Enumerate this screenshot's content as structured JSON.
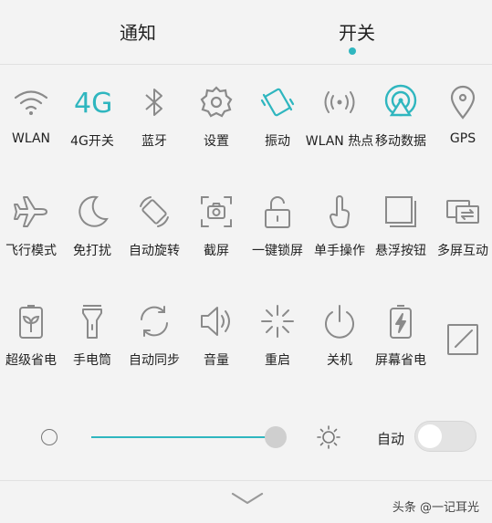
{
  "tabs": {
    "notify": "通知",
    "switch": "开关"
  },
  "tiles": {
    "wlan": "WLAN",
    "fourg_icon": "4G",
    "fourg": "4G开关",
    "bluetooth": "蓝牙",
    "settings": "设置",
    "vibrate": "振动",
    "hotspot": "WLAN 热点",
    "mobile_data": "移动数据",
    "gps": "GPS",
    "airplane": "飞行模式",
    "dnd": "免打扰",
    "autorotate": "自动旋转",
    "screenshot": "截屏",
    "lock": "一键锁屏",
    "one_hand": "单手操作",
    "float": "悬浮按钮",
    "multiscreen": "多屏互动",
    "power_saver": "超级省电",
    "flashlight": "手电筒",
    "sync": "自动同步",
    "volume": "音量",
    "restart": "重启",
    "shutdown": "关机",
    "screen_saver": "屏幕省电"
  },
  "brightness": {
    "auto_label": "自动",
    "level": 1.0,
    "auto_enabled": false
  },
  "watermark": "头条 @一记耳光",
  "colors": {
    "accent": "#2fb6bf",
    "icon": "#8a8a8a",
    "background": "#f3f3f3"
  }
}
